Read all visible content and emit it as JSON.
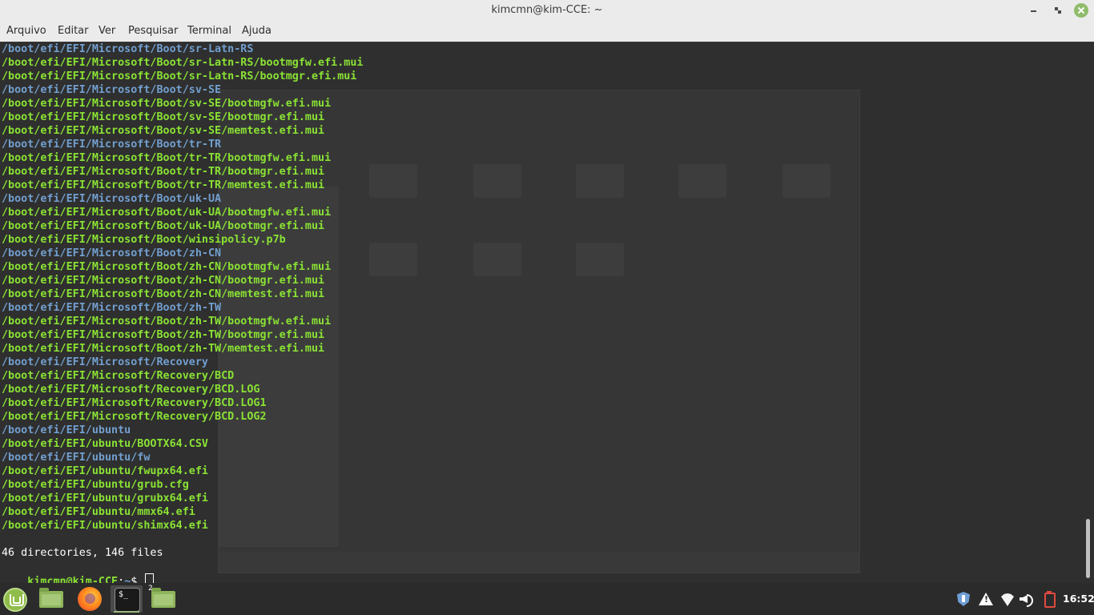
{
  "window": {
    "title": "kimcmn@kim-CCE: ~"
  },
  "menu": {
    "items": [
      "Arquivo",
      "Editar",
      "Ver",
      "Pesquisar",
      "Terminal",
      "Ajuda"
    ]
  },
  "terminal": {
    "lines": [
      {
        "text": "/boot/efi/EFI/Microsoft/Boot/sr-Latn-RS",
        "kind": "dir"
      },
      {
        "text": "/boot/efi/EFI/Microsoft/Boot/sr-Latn-RS/bootmgfw.efi.mui",
        "kind": "file"
      },
      {
        "text": "/boot/efi/EFI/Microsoft/Boot/sr-Latn-RS/bootmgr.efi.mui",
        "kind": "file"
      },
      {
        "text": "/boot/efi/EFI/Microsoft/Boot/sv-SE",
        "kind": "dir"
      },
      {
        "text": "/boot/efi/EFI/Microsoft/Boot/sv-SE/bootmgfw.efi.mui",
        "kind": "file"
      },
      {
        "text": "/boot/efi/EFI/Microsoft/Boot/sv-SE/bootmgr.efi.mui",
        "kind": "file"
      },
      {
        "text": "/boot/efi/EFI/Microsoft/Boot/sv-SE/memtest.efi.mui",
        "kind": "file"
      },
      {
        "text": "/boot/efi/EFI/Microsoft/Boot/tr-TR",
        "kind": "dir"
      },
      {
        "text": "/boot/efi/EFI/Microsoft/Boot/tr-TR/bootmgfw.efi.mui",
        "kind": "file"
      },
      {
        "text": "/boot/efi/EFI/Microsoft/Boot/tr-TR/bootmgr.efi.mui",
        "kind": "file"
      },
      {
        "text": "/boot/efi/EFI/Microsoft/Boot/tr-TR/memtest.efi.mui",
        "kind": "file"
      },
      {
        "text": "/boot/efi/EFI/Microsoft/Boot/uk-UA",
        "kind": "dir"
      },
      {
        "text": "/boot/efi/EFI/Microsoft/Boot/uk-UA/bootmgfw.efi.mui",
        "kind": "file"
      },
      {
        "text": "/boot/efi/EFI/Microsoft/Boot/uk-UA/bootmgr.efi.mui",
        "kind": "file"
      },
      {
        "text": "/boot/efi/EFI/Microsoft/Boot/winsipolicy.p7b",
        "kind": "file"
      },
      {
        "text": "/boot/efi/EFI/Microsoft/Boot/zh-CN",
        "kind": "dir"
      },
      {
        "text": "/boot/efi/EFI/Microsoft/Boot/zh-CN/bootmgfw.efi.mui",
        "kind": "file"
      },
      {
        "text": "/boot/efi/EFI/Microsoft/Boot/zh-CN/bootmgr.efi.mui",
        "kind": "file"
      },
      {
        "text": "/boot/efi/EFI/Microsoft/Boot/zh-CN/memtest.efi.mui",
        "kind": "file"
      },
      {
        "text": "/boot/efi/EFI/Microsoft/Boot/zh-TW",
        "kind": "dir"
      },
      {
        "text": "/boot/efi/EFI/Microsoft/Boot/zh-TW/bootmgfw.efi.mui",
        "kind": "file"
      },
      {
        "text": "/boot/efi/EFI/Microsoft/Boot/zh-TW/bootmgr.efi.mui",
        "kind": "file"
      },
      {
        "text": "/boot/efi/EFI/Microsoft/Boot/zh-TW/memtest.efi.mui",
        "kind": "file"
      },
      {
        "text": "/boot/efi/EFI/Microsoft/Recovery",
        "kind": "dir"
      },
      {
        "text": "/boot/efi/EFI/Microsoft/Recovery/BCD",
        "kind": "file"
      },
      {
        "text": "/boot/efi/EFI/Microsoft/Recovery/BCD.LOG",
        "kind": "file"
      },
      {
        "text": "/boot/efi/EFI/Microsoft/Recovery/BCD.LOG1",
        "kind": "file"
      },
      {
        "text": "/boot/efi/EFI/Microsoft/Recovery/BCD.LOG2",
        "kind": "file"
      },
      {
        "text": "/boot/efi/EFI/ubuntu",
        "kind": "dir"
      },
      {
        "text": "/boot/efi/EFI/ubuntu/BOOTX64.CSV",
        "kind": "file"
      },
      {
        "text": "/boot/efi/EFI/ubuntu/fw",
        "kind": "dir"
      },
      {
        "text": "/boot/efi/EFI/ubuntu/fwupx64.efi",
        "kind": "file"
      },
      {
        "text": "/boot/efi/EFI/ubuntu/grub.cfg",
        "kind": "file"
      },
      {
        "text": "/boot/efi/EFI/ubuntu/grubx64.efi",
        "kind": "file"
      },
      {
        "text": "/boot/efi/EFI/ubuntu/mmx64.efi",
        "kind": "file"
      },
      {
        "text": "/boot/efi/EFI/ubuntu/shimx64.efi",
        "kind": "file"
      }
    ],
    "summary": "46 directories, 146 files",
    "prompt": {
      "user_host": "kimcmn@kim-CCE",
      "separator": ":",
      "path": "~",
      "symbol": "$ "
    }
  },
  "taskbar": {
    "apps": [
      {
        "name": "menu-button",
        "icon": "mint-logo-icon"
      },
      {
        "name": "files-launcher",
        "icon": "folder-icon"
      },
      {
        "name": "firefox-launcher",
        "icon": "firefox-icon"
      },
      {
        "name": "terminal-window",
        "icon": "terminal-icon",
        "active": true
      },
      {
        "name": "files-window",
        "icon": "folder-icon",
        "badge": "2"
      }
    ],
    "terminal_icon_text": "$_",
    "files_badge": "2",
    "tray": [
      "shield-icon",
      "warning-icon",
      "wifi-icon",
      "volume-icon",
      "battery-icon"
    ],
    "clock": "16:52"
  },
  "colors": {
    "directory": "#729fcf",
    "file": "#8ae234",
    "terminal_bg": "#2e2e2e",
    "taskbar_bg": "#2b2b2b",
    "accent": "#8fbc6a"
  }
}
